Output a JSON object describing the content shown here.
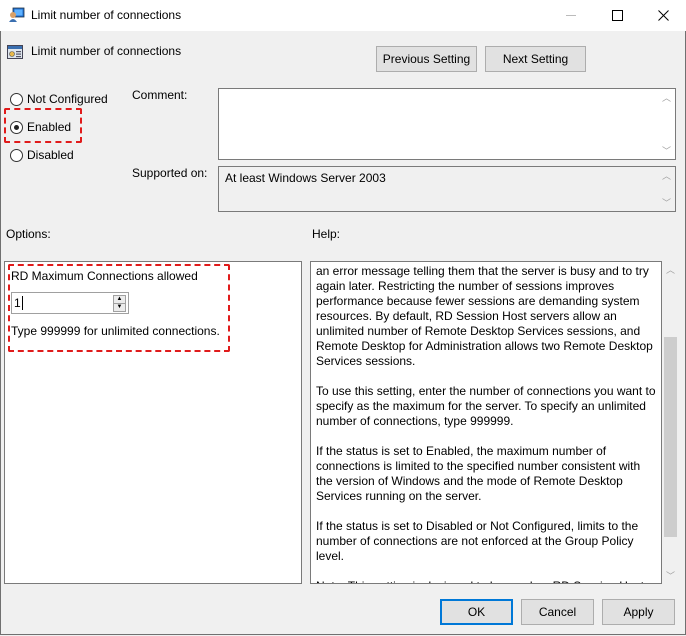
{
  "window": {
    "title": "Limit number of connections",
    "controls": {
      "minimize": "—",
      "maximize": "☐",
      "close": "✕"
    }
  },
  "header": {
    "setting_title": "Limit number of connections",
    "previous_label": "Previous Setting",
    "next_label": "Next Setting"
  },
  "state": {
    "options": [
      {
        "label": "Not Configured",
        "checked": false
      },
      {
        "label": "Enabled",
        "checked": true
      },
      {
        "label": "Disabled",
        "checked": false
      }
    ]
  },
  "comment": {
    "label": "Comment:",
    "value": ""
  },
  "supported": {
    "label": "Supported on:",
    "value": "At least Windows Server 2003"
  },
  "options_panel": {
    "label": "Options:",
    "field_label": "RD Maximum Connections allowed",
    "field_value": "1",
    "hint": "Type 999999 for unlimited connections."
  },
  "help_panel": {
    "label": "Help:",
    "paragraphs": [
      "an error message telling them that the server is busy and to try again later. Restricting the number of sessions improves performance because fewer sessions are demanding system resources. By default, RD Session Host servers allow an unlimited number of Remote Desktop Services sessions, and Remote Desktop for Administration allows two Remote Desktop Services sessions.",
      "To use this setting, enter the number of connections you want to specify as the maximum for the server. To specify an unlimited number of connections, type 999999.",
      "If the status is set to Enabled, the maximum number of connections is limited to the specified number consistent with the version of Windows and the mode of Remote Desktop Services running on the server.",
      "If the status is set to Disabled or Not Configured, limits to the number of connections are not enforced at the Group Policy level.",
      "Note: This setting is designed to be used on RD Session Host servers"
    ]
  },
  "footer": {
    "ok_label": "OK",
    "cancel_label": "Cancel",
    "apply_label": "Apply"
  },
  "colors": {
    "highlight": "#e01b1b",
    "focus": "#0078d7"
  }
}
